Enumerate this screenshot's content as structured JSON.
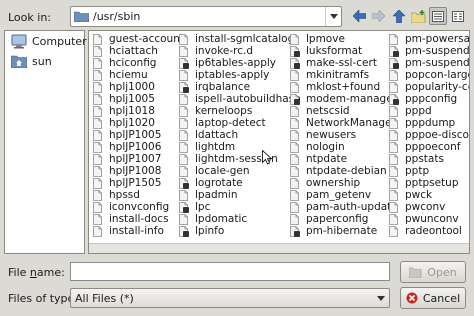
{
  "toolbar": {
    "look_in_label": "Look in:",
    "path": "/usr/sbin"
  },
  "sidebar": {
    "items": [
      {
        "label": "Computer",
        "icon": "computer-icon"
      },
      {
        "label": "sun",
        "icon": "home-folder-icon"
      }
    ]
  },
  "files": {
    "columns": [
      [
        "guest-account",
        "hciattach",
        "hciconfig",
        "hciemu",
        "hplj1000",
        "hplj1005",
        "hplj1018",
        "hplj1020",
        "hplJP1005",
        "hplJP1006",
        "hplJP1007",
        "hplJP1008",
        "hplJP1505",
        "hpssd",
        "iconvconfig",
        "install-docs",
        "install-info"
      ],
      [
        "install-sgmlcatalog",
        "invoke-rc.d",
        "ip6tables-apply",
        "iptables-apply",
        "irqbalance",
        "ispell-autobuildhash",
        "kerneloops",
        "laptop-detect",
        "ldattach",
        "lightdm",
        "lightdm-session",
        "locale-gen",
        "logrotate",
        "lpadmin",
        "lpc",
        "lpdomatic",
        "lpinfo"
      ],
      [
        "lpmove",
        "luksformat",
        "make-ssl-cert",
        "mkinitramfs",
        "mklost+found",
        "modem-manager",
        "netscsid",
        "NetworkManager",
        "newusers",
        "nologin",
        "ntpdate",
        "ntpdate-debian",
        "ownership",
        "pam_getenv",
        "pam-auth-update",
        "paperconfig",
        "pm-hibernate"
      ],
      [
        "pm-powersave",
        "pm-suspend",
        "pm-suspend-hybrid",
        "popcon-largest-unused",
        "popularity-contest",
        "pppconfig",
        "pppd",
        "pppdump",
        "pppoe-discovery",
        "pppoeconf",
        "ppstats",
        "pptp",
        "pptpsetup",
        "pwck",
        "pwconv",
        "pwunconv",
        "radeontool"
      ]
    ],
    "badged": [
      [],
      [
        2,
        4,
        12,
        14,
        16
      ],
      [
        1,
        2,
        5,
        16
      ],
      [
        1,
        2,
        5
      ]
    ]
  },
  "filename": {
    "label": "File name:",
    "value": ""
  },
  "filetype": {
    "label": "Files of type:",
    "value": "All Files (*)"
  },
  "buttons": {
    "open": "Open",
    "cancel": "Cancel"
  },
  "colors": {
    "folder": "#6f8fb8",
    "nav_arrow": "#3b6db5",
    "cancel_icon": "#c62a1f"
  }
}
